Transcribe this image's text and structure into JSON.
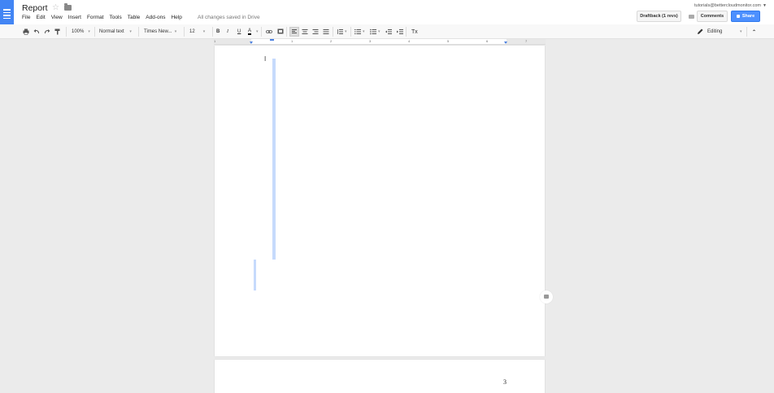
{
  "header": {
    "title": "Report",
    "star": "☆",
    "status": "All changes saved in Drive",
    "user_email": "tutorials@bettercloudmonitor.com",
    "user_dropdown": "▼",
    "draftback": "Draftback (1 revs)",
    "comments": "Comments",
    "share": "Share"
  },
  "menu": [
    "File",
    "Edit",
    "View",
    "Insert",
    "Format",
    "Tools",
    "Table",
    "Add-ons",
    "Help"
  ],
  "toolbar": {
    "zoom": "100%",
    "style": "Normal text",
    "font": "Times New...",
    "size": "12",
    "bold": "B",
    "italic": "I",
    "underline": "U",
    "text_color": "A",
    "clear_format": "Tx",
    "mode": "Editing",
    "dropdown": "▾",
    "collapse": "⌃"
  },
  "ruler": [
    "1",
    "1",
    "2",
    "3",
    "4",
    "5",
    "6",
    "7"
  ],
  "document": {
    "page_number": "3",
    "cursor": "I"
  },
  "colors": {
    "accent": "#4285f4",
    "share": "#4d90fe",
    "selection": "#c6dafc"
  }
}
